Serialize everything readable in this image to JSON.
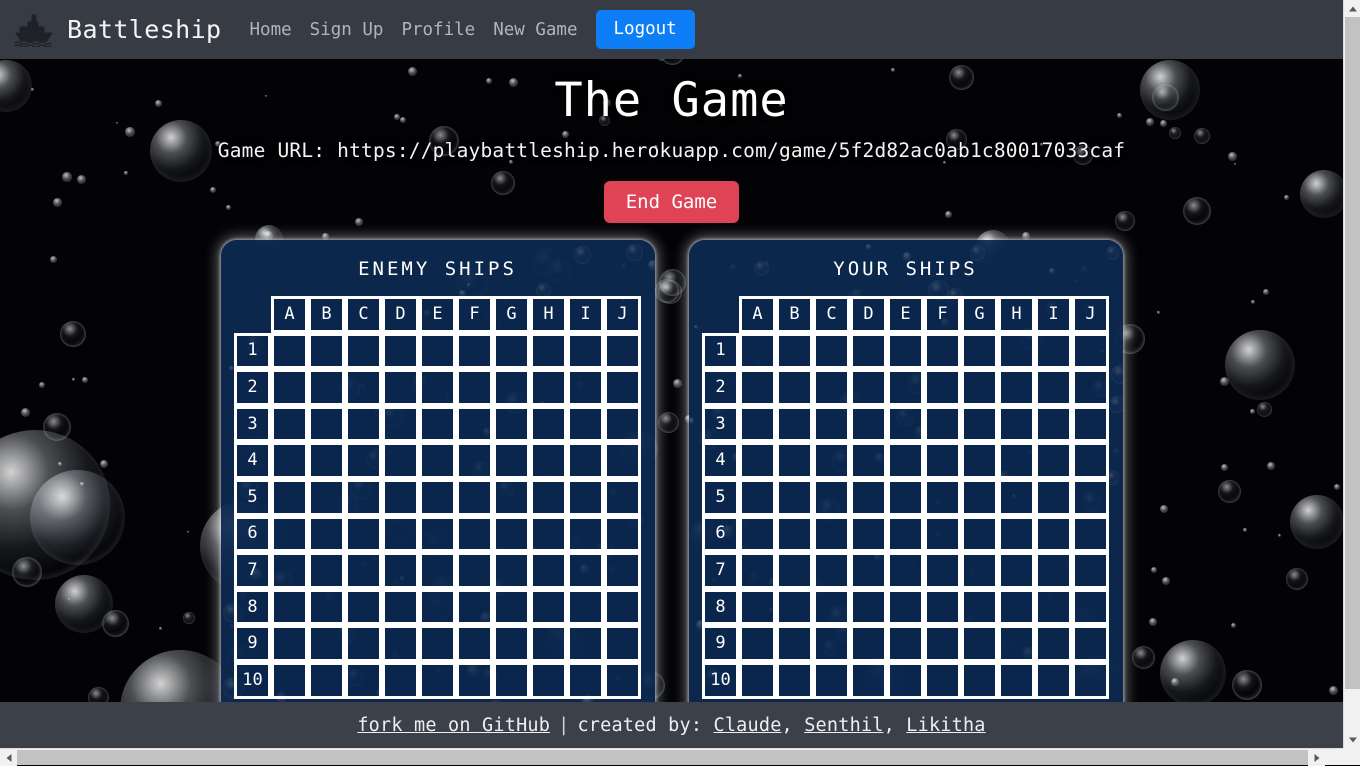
{
  "navbar": {
    "brand": "Battleship",
    "brand_icon": "ship-icon",
    "links": [
      {
        "label": "Home"
      },
      {
        "label": "Sign Up"
      },
      {
        "label": "Profile"
      },
      {
        "label": "New Game"
      }
    ],
    "logout_label": "Logout",
    "background_color": "#373c44",
    "logout_color": "#0d7ef5",
    "link_color": "#adb5bd"
  },
  "main": {
    "title": "The Game",
    "game_url_label": "Game URL:",
    "game_url": "https://playbattleship.herokuapp.com/game/5f2d82ac0ab1c80017033caf",
    "game_url_full": "Game URL: https://playbattleship.herokuapp.com/game/5f2d82ac0ab1c80017033caf",
    "end_game_label": "End Game",
    "end_game_color": "#e04356"
  },
  "boards": [
    {
      "title": "ENEMY SHIPS",
      "column_headers": [
        "A",
        "B",
        "C",
        "D",
        "E",
        "F",
        "G",
        "H",
        "I",
        "J"
      ],
      "row_labels": [
        "1",
        "2",
        "3",
        "4",
        "5",
        "6",
        "7",
        "8",
        "9",
        "10"
      ],
      "cell_color": "#0a264e",
      "border_color": "#ffffff"
    },
    {
      "title": "YOUR SHIPS",
      "column_headers": [
        "A",
        "B",
        "C",
        "D",
        "E",
        "F",
        "G",
        "H",
        "I",
        "J"
      ],
      "row_labels": [
        "1",
        "2",
        "3",
        "4",
        "5",
        "6",
        "7",
        "8",
        "9",
        "10"
      ],
      "cell_color": "#0a264e",
      "border_color": "#ffffff"
    }
  ],
  "footer": {
    "github_link": "fork me on GitHub",
    "separator": "|",
    "created_by_label": "created by:",
    "authors": [
      "Claude",
      "Senthil",
      "Likitha"
    ],
    "comma": ",",
    "background_color": "#3c4049"
  }
}
